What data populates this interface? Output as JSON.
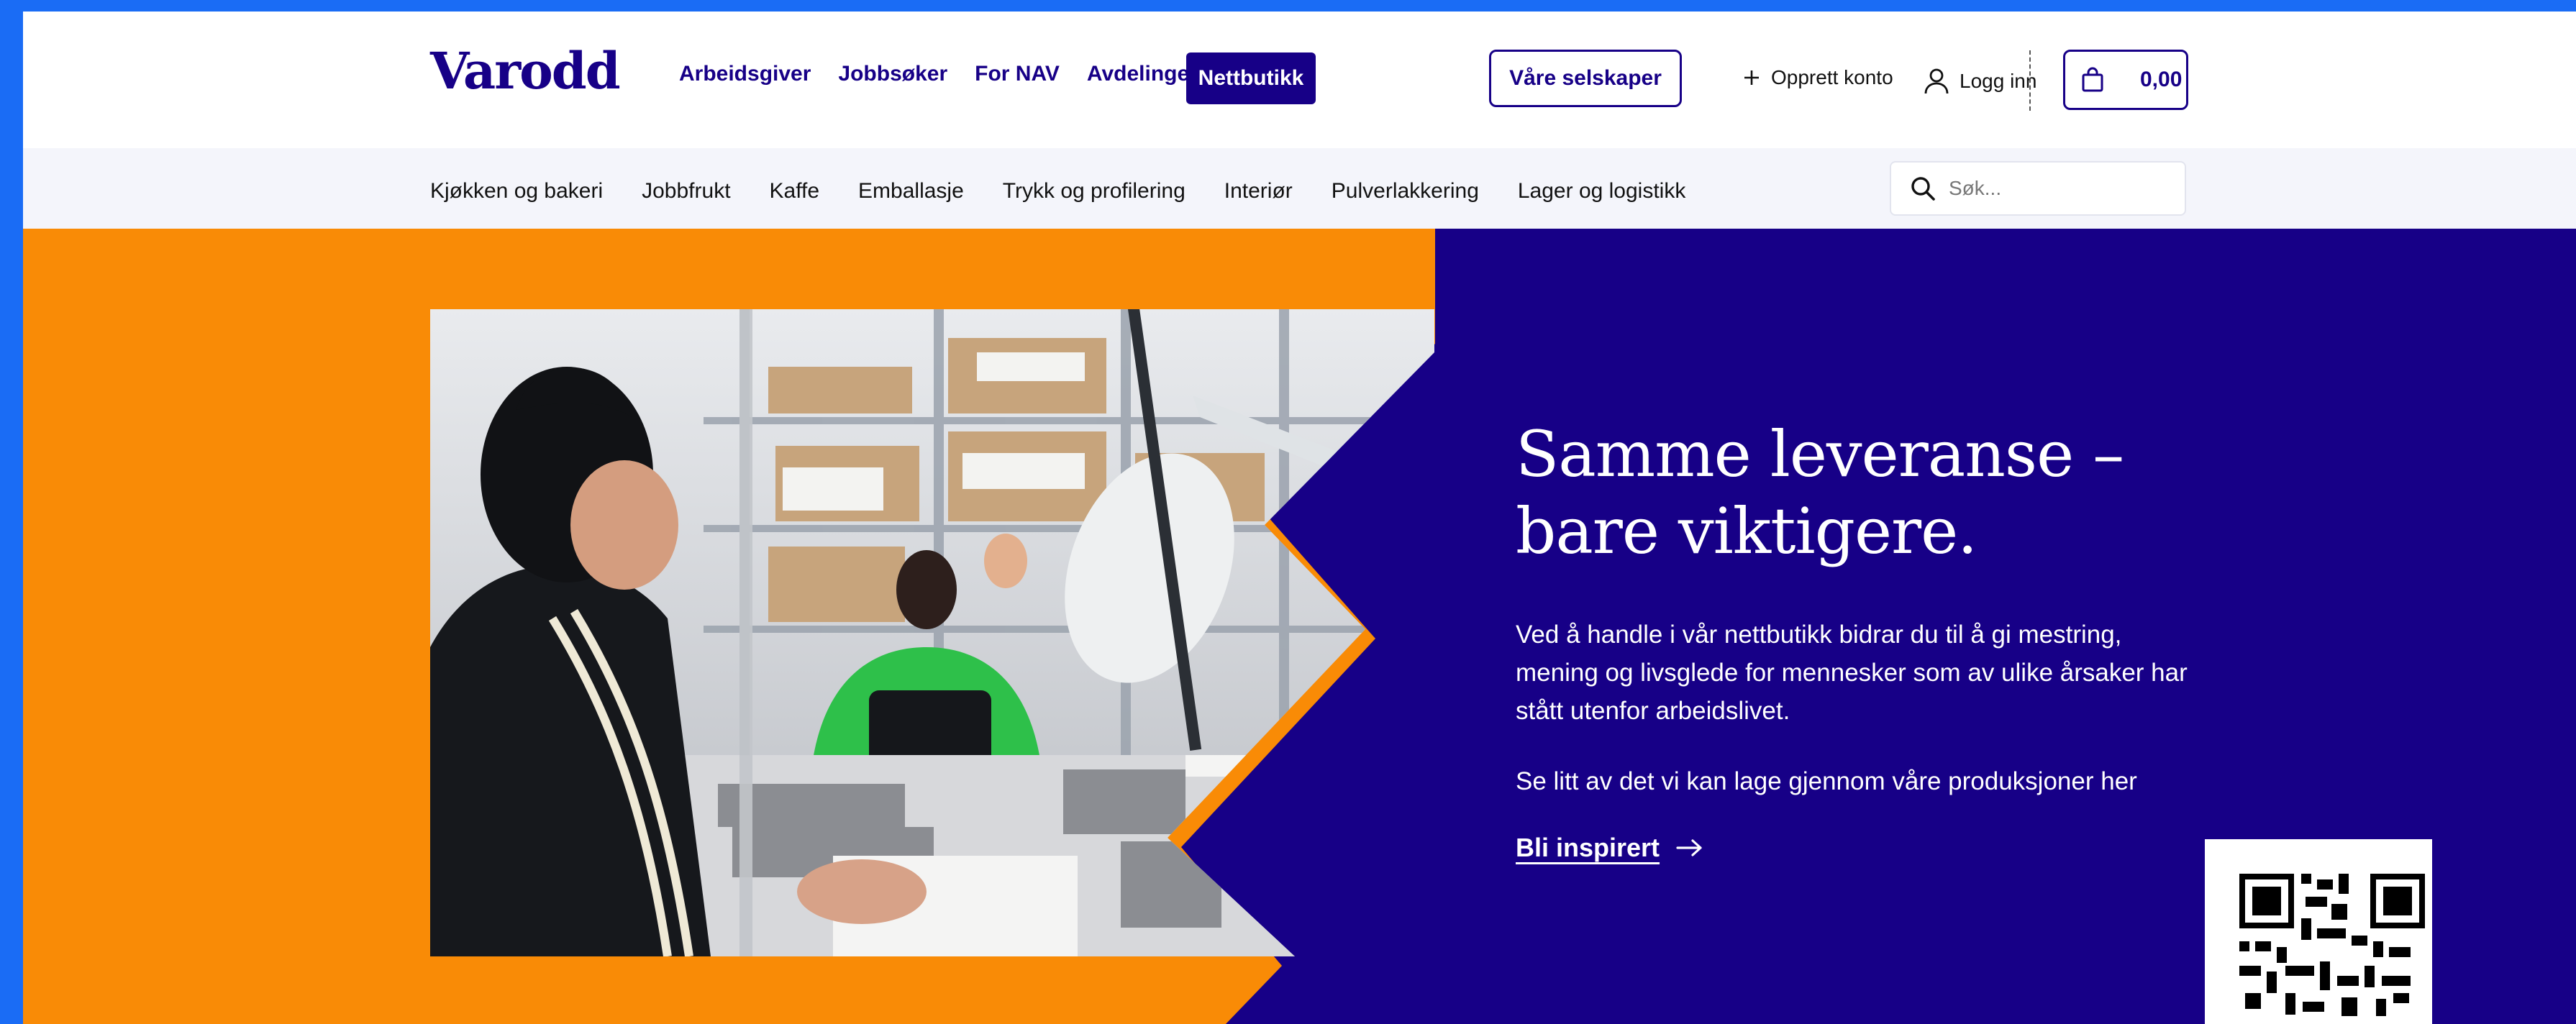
{
  "brand": {
    "logo_text": "Varodd",
    "primary_color": "#170087",
    "accent_color": "#f98b06"
  },
  "header": {
    "nav": [
      {
        "label": "Arbeidsgiver"
      },
      {
        "label": "Jobbsøker"
      },
      {
        "label": "For NAV"
      },
      {
        "label": "Avdelinger"
      }
    ],
    "shop_button": "Nettbutikk",
    "companies_button": "Våre selskaper",
    "create_account": "Opprett konto",
    "login": "Logg inn",
    "cart_total": "0,00"
  },
  "categories": [
    "Kjøkken og bakeri",
    "Jobbfrukt",
    "Kaffe",
    "Emballasje",
    "Trykk og profilering",
    "Interiør",
    "Pulverlakkering",
    "Lager og logistikk"
  ],
  "search": {
    "placeholder": "Søk..."
  },
  "hero": {
    "title_line1": "Samme leveranse –",
    "title_line2": "bare viktigere.",
    "body": "Ved å handle i vår nettbutikk bidrar du til å gi mestring, mening og livsglede for mennesker som av ulike årsaker har stått utenfor arbeidslivet.",
    "body2": "Se litt av det vi kan lage gjennom våre produksjoner her",
    "cta": "Bli inspirert"
  },
  "icons": {
    "plus": "plus-icon",
    "user": "user-icon",
    "cart": "shopping-bag-icon",
    "search": "search-icon",
    "arrow": "arrow-right-icon",
    "qr": "qr-code-icon"
  }
}
